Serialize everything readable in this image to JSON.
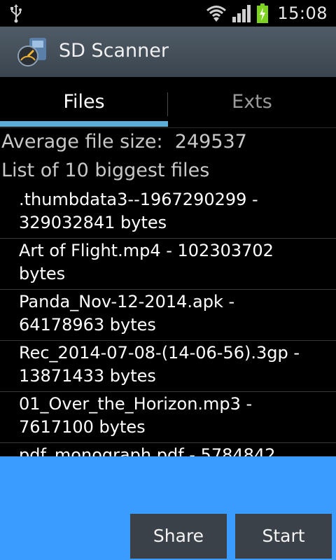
{
  "status_bar": {
    "time": "15:08",
    "icons": [
      "usb-icon",
      "wifi-icon",
      "signal-icon",
      "battery-charging-icon"
    ],
    "battery_color": "#7ed321"
  },
  "app": {
    "title": "SD Scanner",
    "icon": "sd-card-icon",
    "actionbar_color": "#46525c"
  },
  "tabs": [
    {
      "label": "Files",
      "selected": true
    },
    {
      "label": "Exts",
      "selected": false
    }
  ],
  "summary": {
    "avg_label": "Average file size:",
    "avg_value": "249537",
    "list_title": "List of 10 biggest files"
  },
  "files": [
    {
      "text": ".thumbdata3--1967290299 - 329032841 bytes"
    },
    {
      "text": "Art of Flight.mp4 - 102303702 bytes"
    },
    {
      "text": "Panda_Nov-12-2014.apk - 64178963 bytes"
    },
    {
      "text": "Rec_2014-07-08-(14-06-56).3gp - 13871433 bytes"
    },
    {
      "text": "01_Over_the_Horizon.mp3 - 7617100 bytes"
    },
    {
      "text": "pdf_monograph.pdf - 5784842"
    }
  ],
  "buttons": {
    "share": "Share",
    "start": "Start"
  },
  "colors": {
    "tab_indicator": "#5aaed8",
    "bottom_panel": "#3b9cff",
    "button_bg": "#3a4148"
  }
}
